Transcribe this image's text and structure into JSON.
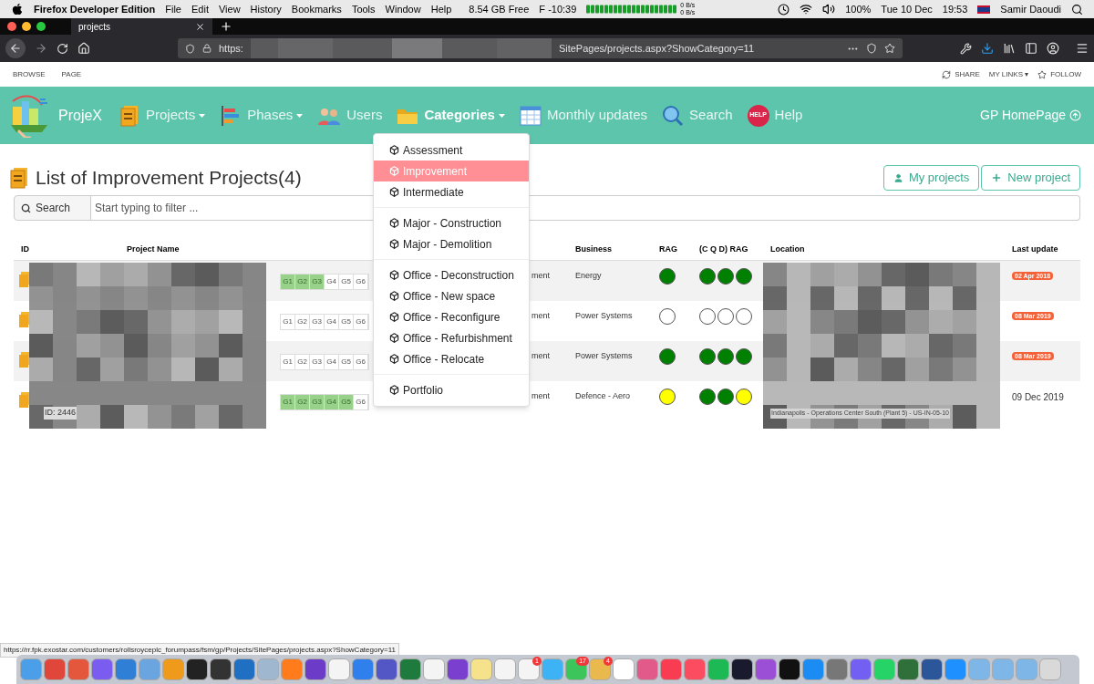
{
  "menubar": {
    "app": "Firefox Developer Edition",
    "menus": [
      "File",
      "Edit",
      "View",
      "History",
      "Bookmarks",
      "Tools",
      "Window",
      "Help"
    ],
    "disk": "8.54 GB Free",
    "timer": "F -10:39",
    "net_up": "0 B/s",
    "net_down": "0 B/s",
    "battery": "100%",
    "date": "Tue 10 Dec",
    "time": "19:53",
    "user": "Samir Daoudi"
  },
  "browser": {
    "tab": "projects",
    "url_start": "https:",
    "url_end": "SitePages/projects.aspx?ShowCategory=11"
  },
  "ribbon": {
    "left": [
      "BROWSE",
      "PAGE"
    ],
    "share": "SHARE",
    "links": "MY LINKS",
    "links_caret": "▾",
    "follow": "FOLLOW"
  },
  "nav": {
    "brand": "ProjeX",
    "items": [
      {
        "label": "Projects",
        "kind": "projects",
        "dropdown": true,
        "selected": false
      },
      {
        "label": "Phases",
        "kind": "phases",
        "dropdown": true,
        "selected": false
      },
      {
        "label": "Users",
        "kind": "users",
        "dropdown": false,
        "selected": false
      },
      {
        "label": "Categories",
        "kind": "categories",
        "dropdown": true,
        "selected": true
      },
      {
        "label": "Monthly updates",
        "kind": "monthly",
        "dropdown": false,
        "selected": false
      },
      {
        "label": "Search",
        "kind": "search",
        "dropdown": false,
        "selected": false
      },
      {
        "label": "Help",
        "kind": "help",
        "dropdown": false,
        "selected": false,
        "icon_text": "HELP"
      }
    ],
    "home": "GP HomePage"
  },
  "categories_menu": [
    [
      {
        "label": "Assessment",
        "selected": false
      },
      {
        "label": "Improvement",
        "selected": true
      },
      {
        "label": "Intermediate",
        "selected": false
      }
    ],
    [
      {
        "label": "Major - Construction",
        "selected": false
      },
      {
        "label": "Major - Demolition",
        "selected": false
      }
    ],
    [
      {
        "label": "Office - Deconstruction",
        "selected": false
      },
      {
        "label": "Office - New space",
        "selected": false
      },
      {
        "label": "Office - Reconfigure",
        "selected": false
      },
      {
        "label": "Office - Refurbishment",
        "selected": false
      },
      {
        "label": "Office - Relocate",
        "selected": false
      }
    ],
    [
      {
        "label": "Portfolio",
        "selected": false
      }
    ]
  ],
  "page": {
    "title": "List of Improvement Projects(4)",
    "buttons": [
      "My projects",
      "New project"
    ],
    "search_label": "Search",
    "search_placeholder": "Start typing to filter ..."
  },
  "table": {
    "columns": [
      "ID",
      "Project Name",
      "Business",
      "RAG",
      "(C Q D) RAG",
      "Location",
      "Last update"
    ],
    "rows": [
      {
        "id": "",
        "segment": "ment",
        "business": "Energy",
        "gates": [
          {
            "label": "G1",
            "done": true
          },
          {
            "label": "G2",
            "done": true
          },
          {
            "label": "G3",
            "done": true
          },
          {
            "label": "G4",
            "done": false
          },
          {
            "label": "G5",
            "done": false
          },
          {
            "label": "G6",
            "done": false
          }
        ],
        "rag": {
          "color": "#008000"
        },
        "cqd": [
          {
            "color": "#008000"
          },
          {
            "color": "#008000"
          },
          {
            "color": "#008000"
          }
        ],
        "location": "",
        "last_update": {
          "text": "02 Apr 2018",
          "overdue": true
        }
      },
      {
        "id": "",
        "segment": "ment",
        "business": "Power Systems",
        "gates": [
          {
            "label": "G1",
            "done": false
          },
          {
            "label": "G2",
            "done": false
          },
          {
            "label": "G3",
            "done": false
          },
          {
            "label": "G4",
            "done": false
          },
          {
            "label": "G5",
            "done": false
          },
          {
            "label": "G6",
            "done": false
          }
        ],
        "rag": {
          "color": "#ffffff"
        },
        "cqd": [
          {
            "color": "#ffffff"
          },
          {
            "color": "#ffffff"
          },
          {
            "color": "#ffffff"
          }
        ],
        "location": "",
        "last_update": {
          "text": "08 Mar 2019",
          "overdue": true
        }
      },
      {
        "id": "",
        "segment": "ment",
        "business": "Power Systems",
        "gates": [
          {
            "label": "G1",
            "done": false
          },
          {
            "label": "G2",
            "done": false
          },
          {
            "label": "G3",
            "done": false
          },
          {
            "label": "G4",
            "done": false
          },
          {
            "label": "G5",
            "done": false
          },
          {
            "label": "G6",
            "done": false
          }
        ],
        "rag": {
          "color": "#008000"
        },
        "cqd": [
          {
            "color": "#008000"
          },
          {
            "color": "#008000"
          },
          {
            "color": "#008000"
          }
        ],
        "location": "",
        "last_update": {
          "text": "08 Mar 2019",
          "overdue": true
        }
      },
      {
        "id": "ID: 2446",
        "segment": "ment",
        "business": "Defence - Aero",
        "gates": [
          {
            "label": "G1",
            "done": true
          },
          {
            "label": "G2",
            "done": true
          },
          {
            "label": "G3",
            "done": true
          },
          {
            "label": "G4",
            "done": true
          },
          {
            "label": "G5",
            "done": true
          },
          {
            "label": "G6",
            "done": false
          }
        ],
        "rag": {
          "color": "#ffff00"
        },
        "cqd": [
          {
            "color": "#008000"
          },
          {
            "color": "#008000"
          },
          {
            "color": "#ffff00"
          }
        ],
        "location": "Indianapolis - Operations Center South (Plant 5) - US-IN-05-10",
        "last_update": {
          "text": "09 Dec 2019",
          "overdue": false
        }
      }
    ]
  },
  "status_url": "https://rr.fpk.exostar.com/customers/rollsroyceplc_forumpass/fsm/gp/Projects/SitePages/projects.aspx?ShowCategory=11",
  "dock_badges": [
    "1",
    "17",
    "4"
  ]
}
